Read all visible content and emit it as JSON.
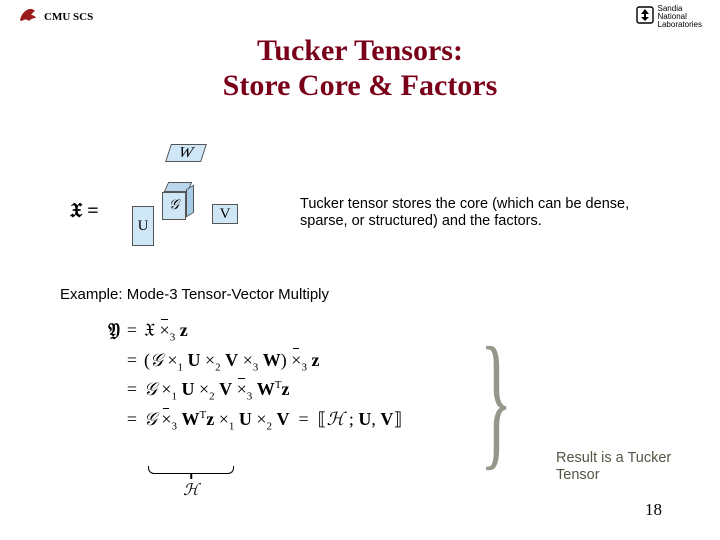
{
  "header": {
    "org": "CMU SCS",
    "sponsor_line1": "Sandia",
    "sponsor_line2": "National",
    "sponsor_line3": "Laboratories"
  },
  "title_line1": "Tucker Tensors:",
  "title_line2": "Store Core & Factors",
  "decomp": {
    "lhs": "𝔛 =",
    "W": "W",
    "G": "𝒢",
    "V": "V",
    "U": "U"
  },
  "explain": "Tucker tensor stores the core (which can be dense, sparse, or structured) and the factors.",
  "example_label": "Example: Mode-3 Tensor-Vector Multiply",
  "equations": {
    "row1_lhs": "𝔜",
    "row1_rhs": "𝔛 ×̄₃ z",
    "row2_rhs": "(𝒢 ×₁ U ×₂ V ×₃ W) ×̄₃ z",
    "row3_rhs": "𝒢 ×₁ U ×₂ V ×̄₃ Wᵀz",
    "row4_rhs": "𝒢 ×̄₃ Wᵀz ×₁ U ×₂ V = ⟦ℋ ; U, V⟧"
  },
  "underbrace_label": "ℋ",
  "result_text": "Result is a Tucker Tensor",
  "page_number": "18"
}
